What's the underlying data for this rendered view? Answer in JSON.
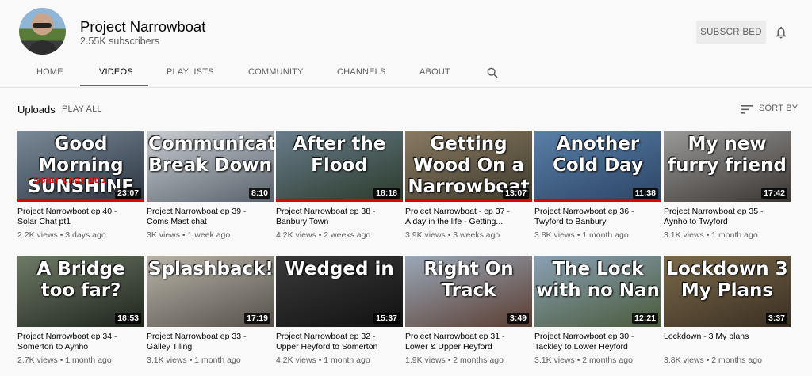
{
  "channel": {
    "name": "Project Narrowboat",
    "subscribers": "2.55K subscribers",
    "subscribe_label": "SUBSCRIBED"
  },
  "tabs": [
    "HOME",
    "VIDEOS",
    "PLAYLISTS",
    "COMMUNITY",
    "CHANNELS",
    "ABOUT"
  ],
  "active_tab": "VIDEOS",
  "section": {
    "title": "Uploads",
    "play_all": "PLAY ALL",
    "sort_label": "SORT BY"
  },
  "colors": {
    "progress": "#e00000",
    "background": "#f9f9f9",
    "secondary_text": "#606060"
  },
  "icons": {
    "bell": "bell-icon",
    "search": "search-icon",
    "sort": "sort-icon"
  },
  "videos": [
    {
      "thumb_text": "Good Morning SUNSHINE",
      "thumb_subtext": "Solar Chat pt 1",
      "duration": "23:07",
      "title_line1": "Project Narrowboat ep 40 -",
      "title_line2": "Solar Chat pt1",
      "views": "2.2K views",
      "age": "3 days ago",
      "progress": 1.0,
      "bg1": "#7b8a98",
      "bg2": "#2b3440"
    },
    {
      "thumb_text": "Communication Break Down",
      "thumb_subtext": "",
      "duration": "8:10",
      "title_line1": "Project Narrowboat ep 39 -",
      "title_line2": "Coms Mast chat",
      "views": "3K views",
      "age": "1 week ago",
      "progress": 0,
      "bg1": "#c9ccd0",
      "bg2": "#59636d"
    },
    {
      "thumb_text": "After the Flood",
      "thumb_subtext": "",
      "duration": "18:18",
      "title_line1": "Project Narrowboat ep 38 -",
      "title_line2": "Banbury Town",
      "views": "4.2K views",
      "age": "2 weeks ago",
      "progress": 1.0,
      "bg1": "#6a7d8c",
      "bg2": "#2a3a2a"
    },
    {
      "thumb_text": "Getting Wood On a Narrowboat",
      "thumb_subtext": "",
      "duration": "13:07",
      "title_line1": "Project Narrowboat - ep 37 -",
      "title_line2": "A day in the life - Getting...",
      "views": "3.9K views",
      "age": "3 weeks ago",
      "progress": 1.0,
      "bg1": "#8a7a62",
      "bg2": "#3d3a2c"
    },
    {
      "thumb_text": "Another Cold Day",
      "thumb_subtext": "",
      "duration": "11:38",
      "title_line1": "Project Narrowboat ep 36 -",
      "title_line2": "Twyford to Banbury",
      "views": "3.8K views",
      "age": "1 month ago",
      "progress": 1.0,
      "bg1": "#5a7fa8",
      "bg2": "#2b4464"
    },
    {
      "thumb_text": "My new furry friend",
      "thumb_subtext": "",
      "duration": "17:42",
      "title_line1": "Project Narrowboat ep 35 -",
      "title_line2": "Aynho to Twyford",
      "views": "3.1K views",
      "age": "1 month ago",
      "progress": 0,
      "bg1": "#9a9a98",
      "bg2": "#3a3533"
    },
    {
      "thumb_text": "A Bridge too far?",
      "thumb_subtext": "",
      "duration": "18:53",
      "title_line1": "Project Narrowboat ep 34 -",
      "title_line2": "Somerton to Aynho",
      "views": "2.7K views",
      "age": "1 month ago",
      "progress": 0,
      "bg1": "#6e7a66",
      "bg2": "#1f241d"
    },
    {
      "thumb_text": "Splashback!",
      "thumb_subtext": "",
      "duration": "17:19",
      "title_line1": "Project Narrowboat ep 33 -",
      "title_line2": "Galley Tiling",
      "views": "3.1K views",
      "age": "1 month ago",
      "progress": 0,
      "bg1": "#b8b4a8",
      "bg2": "#55504a"
    },
    {
      "thumb_text": "Wedged in",
      "thumb_subtext": "",
      "duration": "15:37",
      "title_line1": "Project Narrowboat ep 32 -",
      "title_line2": "Upper Heyford to Somerton",
      "views": "4.2K views",
      "age": "1 month ago",
      "progress": 0,
      "bg1": "#3a3a3a",
      "bg2": "#111111"
    },
    {
      "thumb_text": "Right On Track",
      "thumb_subtext": "",
      "duration": "3:49",
      "title_line1": "Project Narrowboat ep 31 -",
      "title_line2": "Lower & Upper Heyford",
      "views": "1.9K views",
      "age": "2 months ago",
      "progress": 0,
      "bg1": "#9aa8b8",
      "bg2": "#5a3c30"
    },
    {
      "thumb_text": "The Lock with no Nan",
      "thumb_subtext": "",
      "duration": "12:21",
      "title_line1": "Project Narrowboat ep 30 -",
      "title_line2": "Tackley to Lower Heyford",
      "views": "3.1K views",
      "age": "2 months ago",
      "progress": 0,
      "bg1": "#8aa0b4",
      "bg2": "#4a5a3a"
    },
    {
      "thumb_text": "Lockdown 3 My Plans",
      "thumb_subtext": "",
      "duration": "3:37",
      "title_line1": "Lockdown - 3 My plans",
      "title_line2": "",
      "views": "3.8K views",
      "age": "2 months ago",
      "progress": 0,
      "bg1": "#7a6a4a",
      "bg2": "#3a2e22"
    }
  ]
}
